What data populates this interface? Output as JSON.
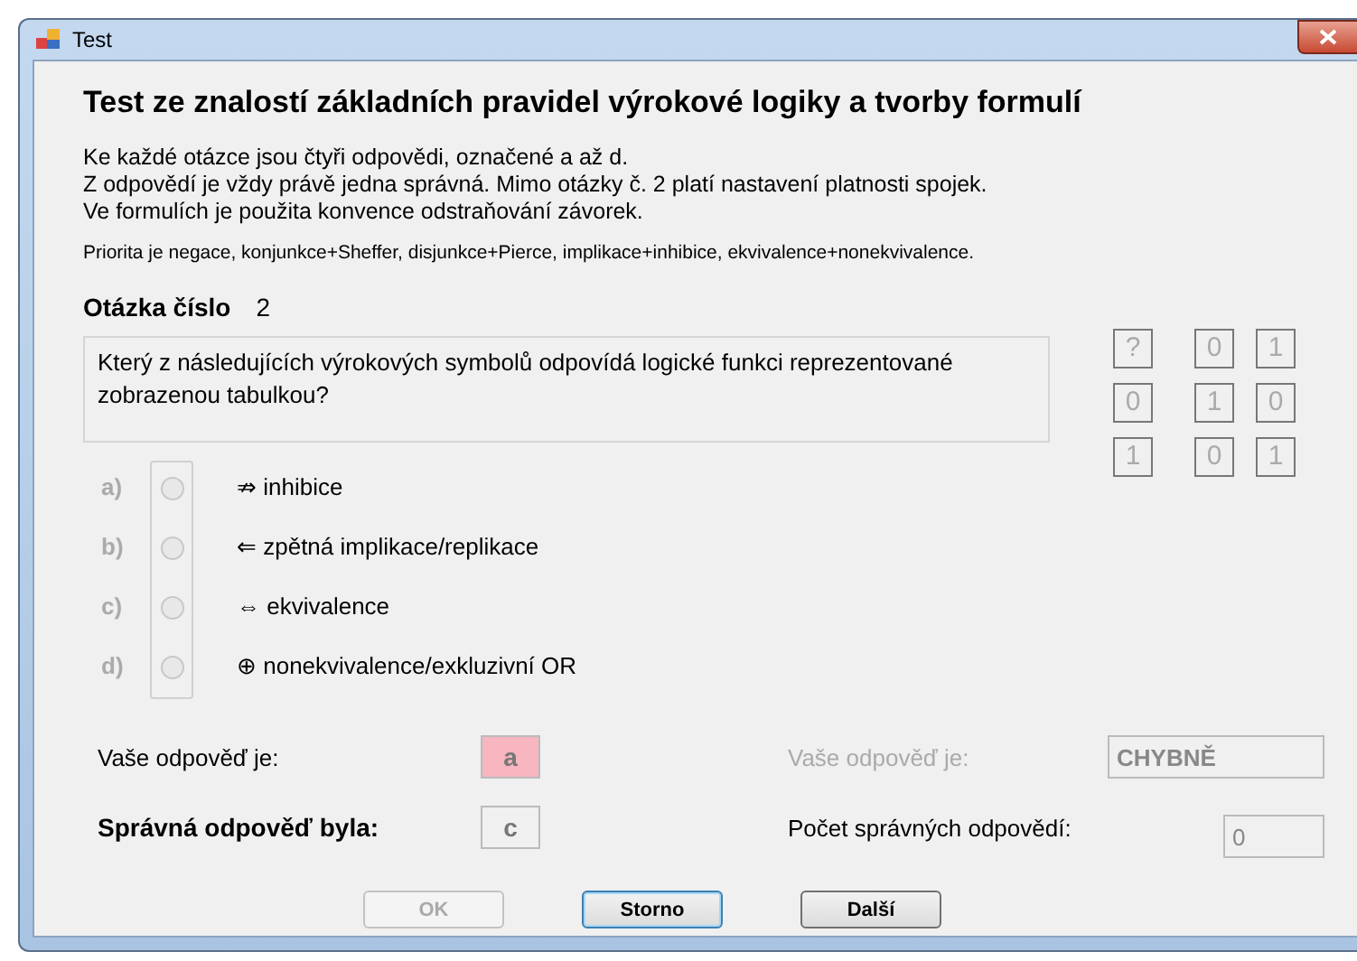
{
  "window": {
    "title": "Test"
  },
  "heading": "Test ze znalostí základních pravidel výrokové logiky a tvorby formulí",
  "intro": [
    "Ke každé otázce jsou čtyři odpovědi, označené a až d.",
    "Z odpovědí je vždy právě jedna správná. Mimo otázky č. 2 platí nastavení platnosti spojek.",
    "Ve formulích je použita konvence odstraňování závorek."
  ],
  "priority": "Priorita je negace, konjunkce+Sheffer, disjunkce+Pierce, implikace+inhibice, ekvivalence+nonekvivalence.",
  "question": {
    "label": "Otázka číslo",
    "number": "2",
    "text": "Který z následujících výrokových symbolů odpovídá logické funkci reprezentované zobrazenou tabulkou?"
  },
  "truth_table": [
    [
      "?",
      "0",
      "1"
    ],
    [
      "0",
      "1",
      "0"
    ],
    [
      "1",
      "0",
      "1"
    ]
  ],
  "options": [
    {
      "letter": "a)",
      "text": "⇏ inhibice",
      "selected": false,
      "disabled": true
    },
    {
      "letter": "b)",
      "text": "⇐ zpětná implikace/replikace",
      "selected": false,
      "disabled": true
    },
    {
      "letter": "c)",
      "text": "⇔ ekvivalence",
      "selected": false,
      "disabled": true
    },
    {
      "letter": "d)",
      "text": "⊕ nonekvivalence/exkluzivní OR",
      "selected": false,
      "disabled": true
    }
  ],
  "your_answer": {
    "label": "Vaše odpověď je:",
    "value": "a",
    "correct": false
  },
  "correct_answer": {
    "label": "Správná odpověď byla:",
    "value": "c"
  },
  "result": {
    "label": "Vaše odpověď je:",
    "value": "CHYBNĚ",
    "disabled": true
  },
  "score": {
    "label": "Počet správných odpovědí:",
    "value": "0",
    "disabled": true
  },
  "buttons": [
    {
      "label": "OK",
      "disabled": true,
      "focused": false
    },
    {
      "label": "Storno",
      "disabled": false,
      "focused": true
    },
    {
      "label": "Další",
      "disabled": false,
      "focused": false
    }
  ]
}
